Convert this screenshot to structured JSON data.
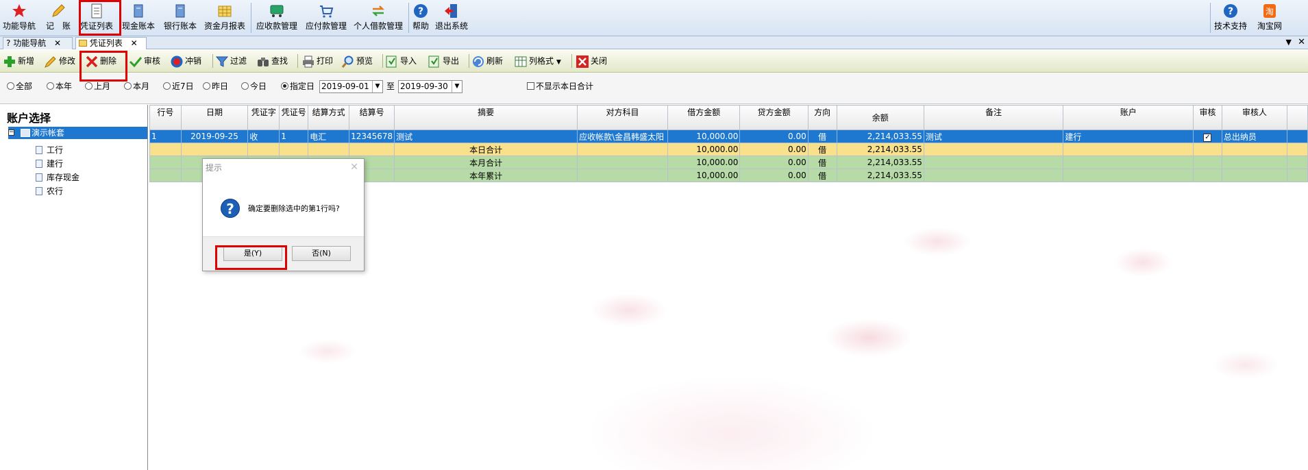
{
  "ribbon": {
    "items": [
      {
        "label": "功能导航",
        "icon": "star-icon"
      },
      {
        "label": "记　账",
        "icon": "pencil-icon"
      },
      {
        "label": "凭证列表",
        "icon": "document-icon"
      },
      {
        "label": "现金账本",
        "icon": "book-icon"
      },
      {
        "label": "银行账本",
        "icon": "book-icon"
      },
      {
        "label": "资金月报表",
        "icon": "grid-icon"
      },
      {
        "label": "应收款管理",
        "icon": "truck-icon"
      },
      {
        "label": "应付款管理",
        "icon": "cart-icon"
      },
      {
        "label": "个人借款管理",
        "icon": "exchange-icon"
      },
      {
        "label": "帮助",
        "icon": "help-icon"
      },
      {
        "label": "退出系统",
        "icon": "exit-icon"
      },
      {
        "label": "技术支持",
        "icon": "help-icon"
      },
      {
        "label": "淘宝网",
        "icon": "taobao-icon"
      }
    ]
  },
  "tabs": [
    {
      "label": "功能导航"
    },
    {
      "label": "凭证列表"
    }
  ],
  "toolbar": {
    "items": [
      {
        "label": "新增",
        "icon": "plus-icon"
      },
      {
        "label": "修改",
        "icon": "pencil-icon"
      },
      {
        "label": "删除",
        "icon": "delete-icon"
      },
      {
        "label": "审核",
        "icon": "check-icon"
      },
      {
        "label": "冲销",
        "icon": "record-icon"
      },
      {
        "label": "过滤",
        "icon": "filter-icon"
      },
      {
        "label": "查找",
        "icon": "binoculars-icon"
      },
      {
        "label": "打印",
        "icon": "printer-icon"
      },
      {
        "label": "预览",
        "icon": "magnifier-icon"
      },
      {
        "label": "导入",
        "icon": "import-icon"
      },
      {
        "label": "导出",
        "icon": "export-icon"
      },
      {
        "label": "刷新",
        "icon": "refresh-icon"
      },
      {
        "label": "列格式",
        "icon": "columns-icon"
      },
      {
        "label": "关闭",
        "icon": "close-icon"
      }
    ]
  },
  "filter": {
    "radios": [
      "全部",
      "本年",
      "上月",
      "本月",
      "近7日",
      "昨日",
      "今日",
      "指定日"
    ],
    "selected": "指定日",
    "date_from": "2019-09-01",
    "to_label": "至",
    "date_to": "2019-09-30",
    "hide_today_label": "不显示本日合计"
  },
  "left": {
    "title": "账户选择",
    "root": "演示帐套",
    "items": [
      "工行",
      "建行",
      "库存现金",
      "农行"
    ]
  },
  "grid": {
    "headers": [
      "行号",
      "日期",
      "凭证字",
      "凭证号",
      "结算方式",
      "结算号",
      "摘要",
      "对方科目",
      "借方金额",
      "贷方金额",
      "方向",
      "余额",
      "备注",
      "账户",
      "审核",
      "审核人"
    ],
    "row": {
      "no": "1",
      "date": "2019-09-25",
      "word": "收",
      "num": "1",
      "method": "电汇",
      "settle": "12345678",
      "summary": "测试",
      "account": "应收帐款\\金昌韩盛太阳",
      "debit": "10,000.00",
      "credit": "0.00",
      "dir": "借",
      "balance": "2,214,033.55",
      "remark": "测试",
      "acct": "建行",
      "checked": "✓",
      "checker": "总出纳员"
    },
    "totals": [
      {
        "label": "本日合计",
        "debit": "10,000.00",
        "credit": "0.00",
        "dir": "借",
        "balance": "2,214,033.55"
      },
      {
        "label": "本月合计",
        "debit": "10,000.00",
        "credit": "0.00",
        "dir": "借",
        "balance": "2,214,033.55"
      },
      {
        "label": "本年累计",
        "debit": "10,000.00",
        "credit": "0.00",
        "dir": "借",
        "balance": "2,214,033.55"
      }
    ]
  },
  "dialog": {
    "title": "提示",
    "message": "确定要删除选中的第1行吗?",
    "yes": "是(Y)",
    "no": "否(N)"
  },
  "colors": {
    "accent": "#1e78d0",
    "highlight": "#e00000",
    "day_total": "#f9e08a",
    "totals": "#b6dba6"
  }
}
